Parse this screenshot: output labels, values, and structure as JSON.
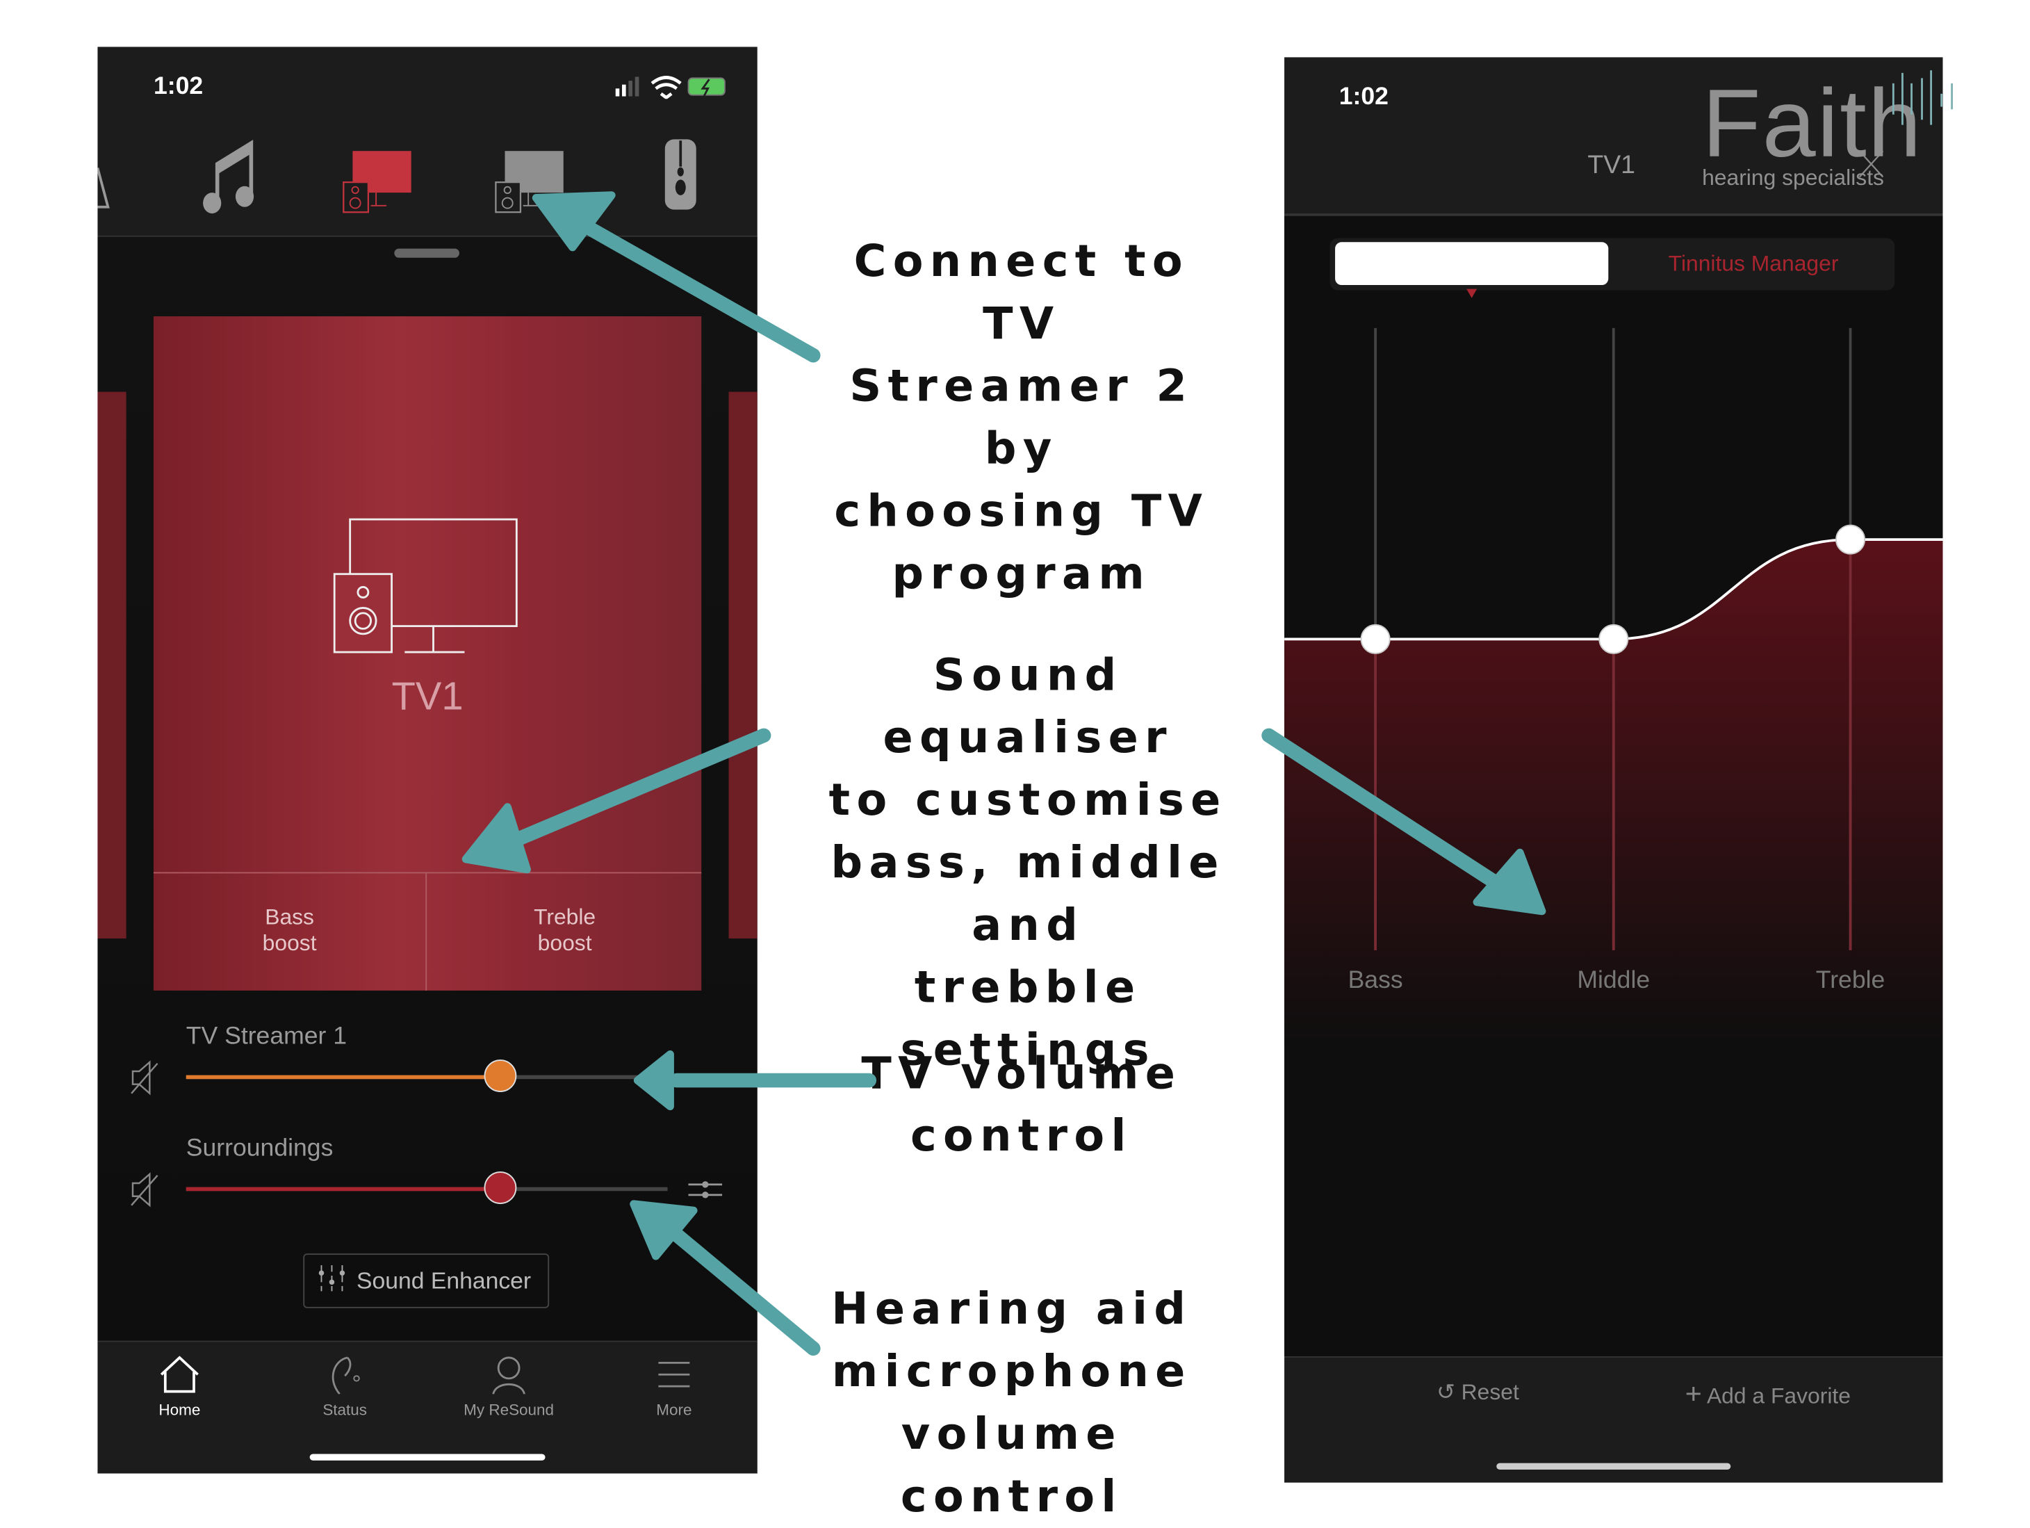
{
  "left_phone": {
    "status_time": "1:02",
    "program_icons": [
      "tree-icon",
      "music-icon",
      "tv-streamer-icon",
      "tv-streamer-2-icon",
      "remote-icon"
    ],
    "active_program_index": 2,
    "card": {
      "title": "TV1",
      "bass_label_1": "Bass",
      "bass_label_2": "boost",
      "treble_label_1": "Treble",
      "treble_label_2": "boost"
    },
    "sliders": [
      {
        "label": "TV Streamer 1",
        "value_percent": 65,
        "color": "#e07b2e"
      },
      {
        "label": "Surroundings",
        "value_percent": 65,
        "color": "#a8242f"
      }
    ],
    "sound_enhancer": "Sound Enhancer",
    "nav": [
      {
        "label": "Home"
      },
      {
        "label": "Status"
      },
      {
        "label": "My ReSound"
      },
      {
        "label": "More"
      }
    ]
  },
  "right_phone": {
    "status_time": "1:02",
    "title": "TV1",
    "logo_text": "Faith",
    "logo_sub": "hearing specialists",
    "tabs": [
      {
        "label": ""
      },
      {
        "label": "Tinnitus Manager"
      }
    ],
    "eq": [
      {
        "label": "Bass",
        "level": 0.5
      },
      {
        "label": "Middle",
        "level": 0.5
      },
      {
        "label": "Treble",
        "level": 0.66
      }
    ],
    "reset": "Reset",
    "add_favorite": "Add a Favorite"
  },
  "annotations": {
    "a1": [
      "Connect to TV",
      "Streamer 2 by",
      "choosing TV",
      "program"
    ],
    "a2": [
      "Sound equaliser",
      "to customise",
      "bass, middle and",
      "trebble settings"
    ],
    "a3": [
      "TV volume",
      "control"
    ],
    "a4": [
      "Hearing aid",
      "microphone",
      "volume control"
    ]
  },
  "colors": {
    "accent_red": "#c4343f",
    "arrow_teal": "#55a3a4",
    "orange": "#e07b2e"
  }
}
